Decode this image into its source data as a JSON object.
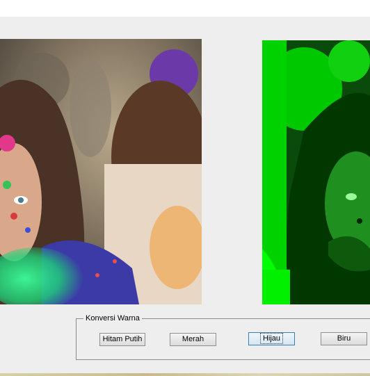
{
  "konversi_panel": {
    "title": "Konversi Warna",
    "buttons": [
      {
        "label": "Hitam Putih"
      },
      {
        "label": "Merah"
      },
      {
        "label": "Hijau"
      },
      {
        "label": "Biru"
      }
    ]
  },
  "colors": {
    "panel_bg": "#eeeeee",
    "green_channel": "#00ff00",
    "focus_border": "#3c7fb1"
  }
}
